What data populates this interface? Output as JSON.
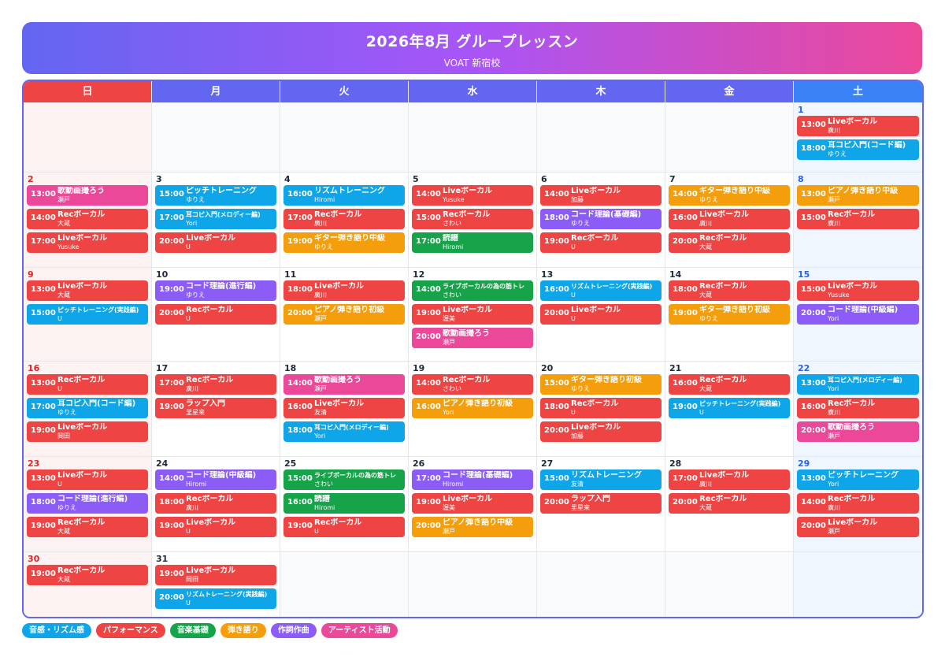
{
  "header": {
    "title": "2026年8月 グループレッスン",
    "subtitle": "VOAT 新宿校"
  },
  "weekdays": [
    "日",
    "月",
    "火",
    "水",
    "木",
    "金",
    "土"
  ],
  "categories": {
    "rhythm": {
      "label": "音感・リズム感",
      "color": "#0ea5e9"
    },
    "perf": {
      "label": "パフォーマンス",
      "color": "#ef4444"
    },
    "theory": {
      "label": "音楽基礎",
      "color": "#16a34a"
    },
    "play": {
      "label": "弾き語り",
      "color": "#f59e0b"
    },
    "write": {
      "label": "作詞作曲",
      "color": "#8b5cf6"
    },
    "artist": {
      "label": "アーティスト活動",
      "color": "#ec4899"
    }
  },
  "legend": [
    "rhythm",
    "perf",
    "theory",
    "play",
    "write",
    "artist"
  ],
  "weeks": [
    [
      null,
      null,
      null,
      null,
      null,
      null,
      {
        "day": "1",
        "events": [
          {
            "time": "13:00",
            "name": "Liveボーカル",
            "teacher": "廣川",
            "cat": "perf"
          },
          {
            "time": "18:00",
            "name": "耳コピ入門(コード編)",
            "teacher": "ゆりえ",
            "cat": "rhythm"
          }
        ]
      }
    ],
    [
      {
        "day": "2",
        "events": [
          {
            "time": "13:00",
            "name": "歌動画撮ろう",
            "teacher": "瀬戸",
            "cat": "artist"
          },
          {
            "time": "14:00",
            "name": "Recボーカル",
            "teacher": "大蔵",
            "cat": "perf"
          },
          {
            "time": "17:00",
            "name": "Liveボーカル",
            "teacher": "Yusuke",
            "cat": "perf"
          }
        ]
      },
      {
        "day": "3",
        "events": [
          {
            "time": "15:00",
            "name": "ピッチトレーニング",
            "teacher": "ゆりえ",
            "cat": "rhythm"
          },
          {
            "time": "17:00",
            "name": "耳コピ入門(メロディー編)",
            "teacher": "Yori",
            "cat": "rhythm"
          },
          {
            "time": "20:00",
            "name": "Liveボーカル",
            "teacher": "U",
            "cat": "perf"
          }
        ]
      },
      {
        "day": "4",
        "events": [
          {
            "time": "16:00",
            "name": "リズムトレーニング",
            "teacher": "Hiromi",
            "cat": "rhythm"
          },
          {
            "time": "17:00",
            "name": "Recボーカル",
            "teacher": "廣川",
            "cat": "perf"
          },
          {
            "time": "19:00",
            "name": "ギター弾き語り中級",
            "teacher": "ゆりえ",
            "cat": "play"
          }
        ]
      },
      {
        "day": "5",
        "events": [
          {
            "time": "14:00",
            "name": "Liveボーカル",
            "teacher": "Yusuke",
            "cat": "perf"
          },
          {
            "time": "15:00",
            "name": "Recボーカル",
            "teacher": "さわい",
            "cat": "perf"
          },
          {
            "time": "17:00",
            "name": "読譜",
            "teacher": "Hiromi",
            "cat": "theory"
          }
        ]
      },
      {
        "day": "6",
        "events": [
          {
            "time": "14:00",
            "name": "Liveボーカル",
            "teacher": "加藤",
            "cat": "perf"
          },
          {
            "time": "18:00",
            "name": "コード理論(基礎編)",
            "teacher": "ゆりえ",
            "cat": "write"
          },
          {
            "time": "19:00",
            "name": "Recボーカル",
            "teacher": "U",
            "cat": "perf"
          }
        ]
      },
      {
        "day": "7",
        "events": [
          {
            "time": "14:00",
            "name": "ギター弾き語り中級",
            "teacher": "ゆりえ",
            "cat": "play"
          },
          {
            "time": "16:00",
            "name": "Liveボーカル",
            "teacher": "廣川",
            "cat": "perf"
          },
          {
            "time": "20:00",
            "name": "Recボーカル",
            "teacher": "大蔵",
            "cat": "perf"
          }
        ]
      },
      {
        "day": "8",
        "events": [
          {
            "time": "13:00",
            "name": "ピアノ弾き語り中級",
            "teacher": "瀬戸",
            "cat": "play"
          },
          {
            "time": "15:00",
            "name": "Recボーカル",
            "teacher": "廣川",
            "cat": "perf"
          }
        ]
      }
    ],
    [
      {
        "day": "9",
        "events": [
          {
            "time": "13:00",
            "name": "Liveボーカル",
            "teacher": "大蔵",
            "cat": "perf"
          },
          {
            "time": "15:00",
            "name": "ピッチトレーニング(実践編)",
            "teacher": "U",
            "cat": "rhythm"
          }
        ]
      },
      {
        "day": "10",
        "events": [
          {
            "time": "19:00",
            "name": "コード理論(進行編)",
            "teacher": "ゆりえ",
            "cat": "write"
          },
          {
            "time": "20:00",
            "name": "Recボーカル",
            "teacher": "U",
            "cat": "perf"
          }
        ]
      },
      {
        "day": "11",
        "events": [
          {
            "time": "18:00",
            "name": "Liveボーカル",
            "teacher": "廣川",
            "cat": "perf"
          },
          {
            "time": "20:00",
            "name": "ピアノ弾き語り初級",
            "teacher": "瀬戸",
            "cat": "play"
          }
        ]
      },
      {
        "day": "12",
        "events": [
          {
            "time": "14:00",
            "name": "ライブボーカルの為の筋トレ",
            "teacher": "さわい",
            "cat": "theory"
          },
          {
            "time": "19:00",
            "name": "Liveボーカル",
            "teacher": "渥美",
            "cat": "perf"
          },
          {
            "time": "20:00",
            "name": "歌動画撮ろう",
            "teacher": "瀬戸",
            "cat": "artist"
          }
        ]
      },
      {
        "day": "13",
        "events": [
          {
            "time": "16:00",
            "name": "リズムトレーニング(実践編)",
            "teacher": "U",
            "cat": "rhythm"
          },
          {
            "time": "20:00",
            "name": "Liveボーカル",
            "teacher": "U",
            "cat": "perf"
          }
        ]
      },
      {
        "day": "14",
        "events": [
          {
            "time": "18:00",
            "name": "Recボーカル",
            "teacher": "大蔵",
            "cat": "perf"
          },
          {
            "time": "19:00",
            "name": "ギター弾き語り初級",
            "teacher": "ゆりえ",
            "cat": "play"
          }
        ]
      },
      {
        "day": "15",
        "events": [
          {
            "time": "15:00",
            "name": "Liveボーカル",
            "teacher": "Yusuke",
            "cat": "perf"
          },
          {
            "time": "20:00",
            "name": "コード理論(中級編)",
            "teacher": "Yori",
            "cat": "write"
          }
        ]
      }
    ],
    [
      {
        "day": "16",
        "events": [
          {
            "time": "13:00",
            "name": "Recボーカル",
            "teacher": "U",
            "cat": "perf"
          },
          {
            "time": "17:00",
            "name": "耳コピ入門(コード編)",
            "teacher": "ゆりえ",
            "cat": "rhythm"
          },
          {
            "time": "19:00",
            "name": "Liveボーカル",
            "teacher": "岡田",
            "cat": "perf"
          }
        ]
      },
      {
        "day": "17",
        "events": [
          {
            "time": "17:00",
            "name": "Recボーカル",
            "teacher": "廣川",
            "cat": "perf"
          },
          {
            "time": "19:00",
            "name": "ラップ入門",
            "teacher": "里星来",
            "cat": "perf"
          }
        ]
      },
      {
        "day": "18",
        "events": [
          {
            "time": "14:00",
            "name": "歌動画撮ろう",
            "teacher": "瀬戸",
            "cat": "artist"
          },
          {
            "time": "16:00",
            "name": "Liveボーカル",
            "teacher": "友清",
            "cat": "perf"
          },
          {
            "time": "18:00",
            "name": "耳コピ入門(メロディー編)",
            "teacher": "Yori",
            "cat": "rhythm"
          }
        ]
      },
      {
        "day": "19",
        "events": [
          {
            "time": "14:00",
            "name": "Recボーカル",
            "teacher": "さわい",
            "cat": "perf"
          },
          {
            "time": "16:00",
            "name": "ピアノ弾き語り初級",
            "teacher": "Yori",
            "cat": "play"
          }
        ]
      },
      {
        "day": "20",
        "events": [
          {
            "time": "15:00",
            "name": "ギター弾き語り初級",
            "teacher": "ゆりえ",
            "cat": "play"
          },
          {
            "time": "18:00",
            "name": "Recボーカル",
            "teacher": "U",
            "cat": "perf"
          },
          {
            "time": "20:00",
            "name": "Liveボーカル",
            "teacher": "加藤",
            "cat": "perf"
          }
        ]
      },
      {
        "day": "21",
        "events": [
          {
            "time": "16:00",
            "name": "Recボーカル",
            "teacher": "大蔵",
            "cat": "perf"
          },
          {
            "time": "19:00",
            "name": "ピッチトレーニング(実践編)",
            "teacher": "U",
            "cat": "rhythm"
          }
        ]
      },
      {
        "day": "22",
        "events": [
          {
            "time": "13:00",
            "name": "耳コピ入門(メロディー編)",
            "teacher": "Yori",
            "cat": "rhythm"
          },
          {
            "time": "16:00",
            "name": "Recボーカル",
            "teacher": "廣川",
            "cat": "perf"
          },
          {
            "time": "20:00",
            "name": "歌動画撮ろう",
            "teacher": "瀬戸",
            "cat": "artist"
          }
        ]
      }
    ],
    [
      {
        "day": "23",
        "events": [
          {
            "time": "13:00",
            "name": "Liveボーカル",
            "teacher": "U",
            "cat": "perf"
          },
          {
            "time": "18:00",
            "name": "コード理論(進行編)",
            "teacher": "ゆりえ",
            "cat": "write"
          },
          {
            "time": "19:00",
            "name": "Recボーカル",
            "teacher": "大蔵",
            "cat": "perf"
          }
        ]
      },
      {
        "day": "24",
        "events": [
          {
            "time": "14:00",
            "name": "コード理論(中級編)",
            "teacher": "Hiromi",
            "cat": "write"
          },
          {
            "time": "18:00",
            "name": "Recボーカル",
            "teacher": "廣川",
            "cat": "perf"
          },
          {
            "time": "19:00",
            "name": "Liveボーカル",
            "teacher": "U",
            "cat": "perf"
          }
        ]
      },
      {
        "day": "25",
        "events": [
          {
            "time": "15:00",
            "name": "ライブボーカルの為の筋トレ",
            "teacher": "さわい",
            "cat": "theory"
          },
          {
            "time": "16:00",
            "name": "読譜",
            "teacher": "Hiromi",
            "cat": "theory"
          },
          {
            "time": "19:00",
            "name": "Recボーカル",
            "teacher": "U",
            "cat": "perf"
          }
        ]
      },
      {
        "day": "26",
        "events": [
          {
            "time": "17:00",
            "name": "コード理論(基礎編)",
            "teacher": "Hiromi",
            "cat": "write"
          },
          {
            "time": "19:00",
            "name": "Liveボーカル",
            "teacher": "渥美",
            "cat": "perf"
          },
          {
            "time": "20:00",
            "name": "ピアノ弾き語り中級",
            "teacher": "瀬戸",
            "cat": "play"
          }
        ]
      },
      {
        "day": "27",
        "events": [
          {
            "time": "15:00",
            "name": "リズムトレーニング",
            "teacher": "友清",
            "cat": "rhythm"
          },
          {
            "time": "20:00",
            "name": "ラップ入門",
            "teacher": "里星来",
            "cat": "perf"
          }
        ]
      },
      {
        "day": "28",
        "events": [
          {
            "time": "17:00",
            "name": "Liveボーカル",
            "teacher": "廣川",
            "cat": "perf"
          },
          {
            "time": "20:00",
            "name": "Recボーカル",
            "teacher": "大蔵",
            "cat": "perf"
          }
        ]
      },
      {
        "day": "29",
        "events": [
          {
            "time": "13:00",
            "name": "ピッチトレーニング",
            "teacher": "Yori",
            "cat": "rhythm"
          },
          {
            "time": "14:00",
            "name": "Recボーカル",
            "teacher": "廣川",
            "cat": "perf"
          },
          {
            "time": "20:00",
            "name": "Liveボーカル",
            "teacher": "瀬戸",
            "cat": "perf"
          }
        ]
      }
    ],
    [
      {
        "day": "30",
        "events": [
          {
            "time": "19:00",
            "name": "Recボーカル",
            "teacher": "大蔵",
            "cat": "perf"
          }
        ]
      },
      {
        "day": "31",
        "events": [
          {
            "time": "19:00",
            "name": "Liveボーカル",
            "teacher": "岡田",
            "cat": "perf"
          },
          {
            "time": "20:00",
            "name": "リズムトレーニング(実践編)",
            "teacher": "U",
            "cat": "rhythm"
          }
        ]
      },
      null,
      null,
      null,
      null,
      null
    ]
  ]
}
